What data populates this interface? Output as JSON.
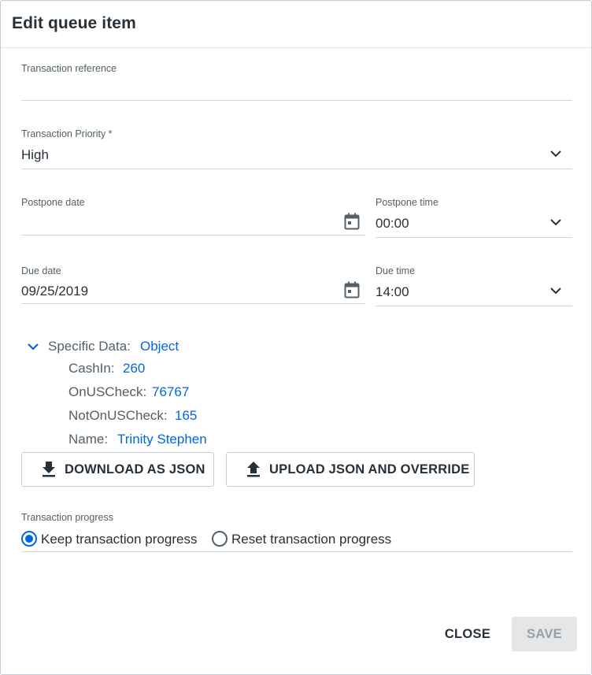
{
  "dialog": {
    "title": "Edit queue item"
  },
  "transaction_reference": {
    "label": "Transaction reference",
    "value": ""
  },
  "priority": {
    "label": "Transaction Priority *",
    "value": "High"
  },
  "postpone_date": {
    "label": "Postpone date",
    "value": ""
  },
  "postpone_time": {
    "label": "Postpone time",
    "value": "00:00"
  },
  "due_date": {
    "label": "Due date",
    "value": "09/25/2019"
  },
  "due_time": {
    "label": "Due time",
    "value": "14:00"
  },
  "specific_data": {
    "label": "Specific Data:",
    "type": "Object",
    "items": [
      {
        "key": "CashIn:",
        "value": "260"
      },
      {
        "key": "OnUSCheck:",
        "value": "76767"
      },
      {
        "key": "NotOnUSCheck:",
        "value": "165"
      },
      {
        "key": "Name:",
        "value": "Trinity Stephen"
      }
    ]
  },
  "buttons": {
    "download": "DOWNLOAD AS JSON",
    "upload": "UPLOAD JSON AND OVERRIDE",
    "close": "CLOSE",
    "save": "SAVE"
  },
  "progress": {
    "label": "Transaction progress",
    "options": [
      {
        "label": "Keep transaction progress",
        "selected": true
      },
      {
        "label": "Reset transaction progress",
        "selected": false
      }
    ]
  },
  "icons": {
    "dropdown": "chevron-down-icon",
    "date": "calendar-icon",
    "expand": "chevron-down-icon",
    "download": "download-icon",
    "upload": "upload-icon"
  },
  "colors": {
    "accent": "#0067df",
    "text": "#273139",
    "muted": "#526069"
  }
}
